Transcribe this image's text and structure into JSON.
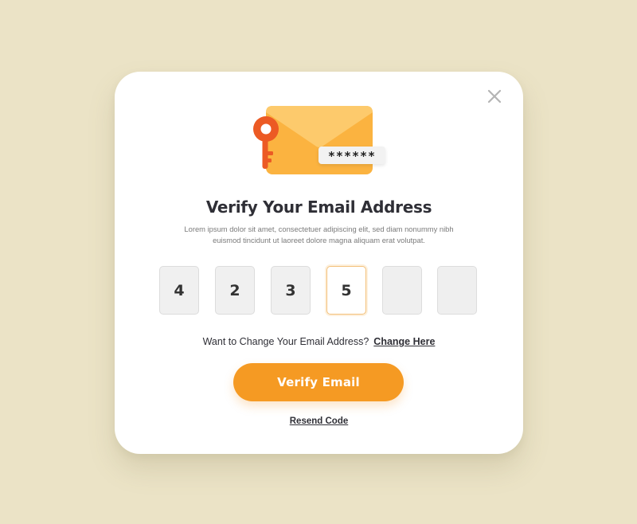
{
  "colors": {
    "page_background": "#ebe3c6",
    "card_background": "#ffffff",
    "accent": "#f59a23",
    "title_text": "#2f2f36",
    "body_text": "#7b7b7b",
    "code_text": "#333333",
    "close_icon": "#b4b4b4",
    "envelope_body": "#fbb340",
    "envelope_flap": "#fdca6c",
    "key": "#ec5a24",
    "password_pill_bg": "#f2f2f2",
    "password_pill_text": "#222222"
  },
  "dialog": {
    "close_icon": "close-icon",
    "illustration": {
      "envelope_icon": "envelope-icon",
      "key_icon": "key-icon",
      "password_mask": "******"
    },
    "title": "Verify Your Email Address",
    "subtitle": "Lorem ipsum dolor sit amet, consectetuer adipiscing elit, sed diam nonummy nibh euismod tincidunt ut laoreet dolore magna aliquam erat volutpat.",
    "code": {
      "digits": [
        "4",
        "2",
        "3",
        "5",
        "",
        ""
      ],
      "active_index": 3
    },
    "change_prompt": "Want to Change Your Email Address?",
    "change_link": "Change Here",
    "verify_button": "Verify Email",
    "resend_link": "Resend Code"
  }
}
